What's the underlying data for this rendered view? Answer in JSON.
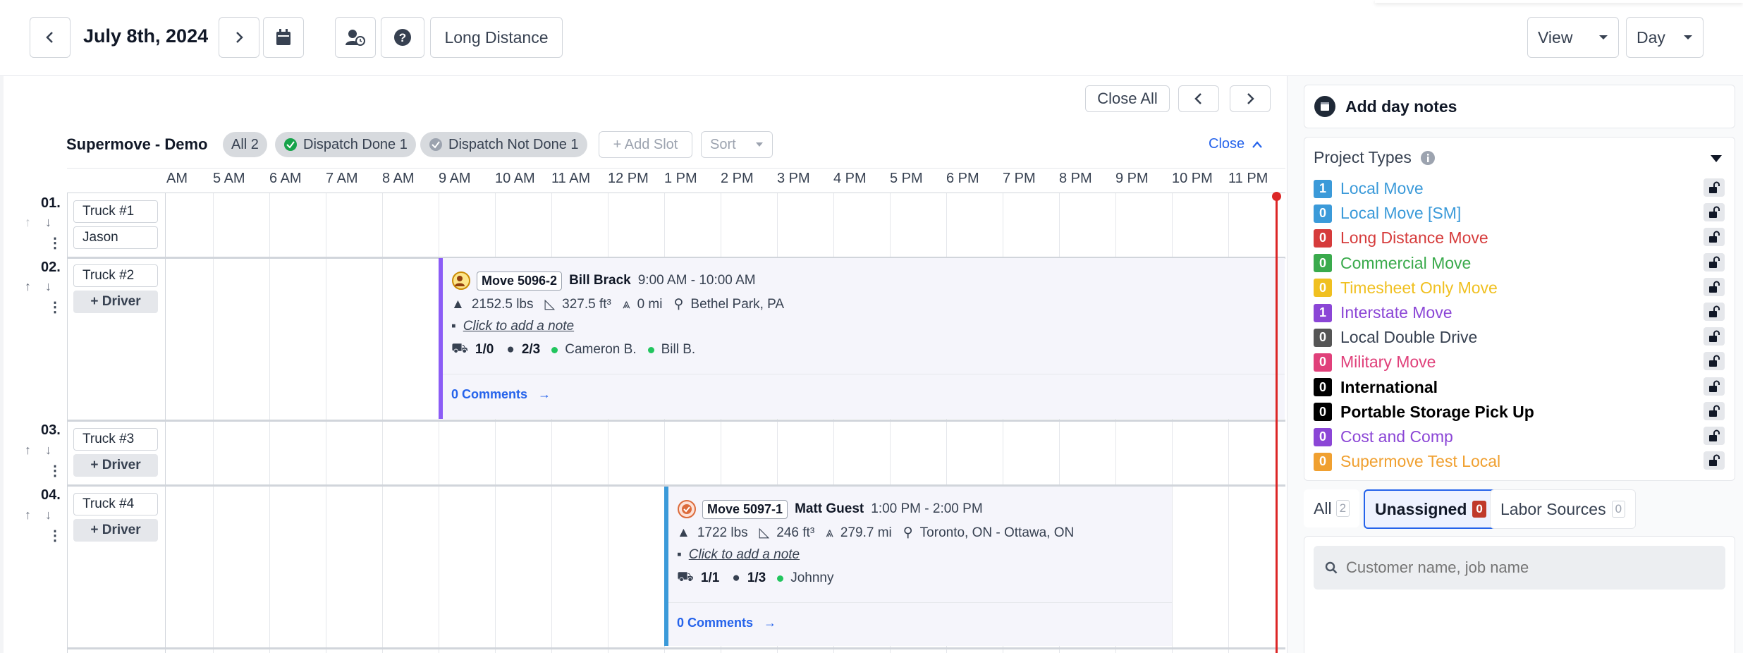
{
  "header": {
    "date": "July 8th, 2024",
    "long_distance": "Long Distance",
    "view_label": "View",
    "day_label": "Day"
  },
  "schedule": {
    "title": "Supermove - Demo",
    "filters": {
      "all": "All 2",
      "dispatch_done": "Dispatch Done 1",
      "dispatch_not_done": "Dispatch Not Done 1"
    },
    "add_slot": "+ Add Slot",
    "sort": "Sort",
    "close": "Close",
    "close_all": "Close All",
    "hours": [
      "AM",
      "5 AM",
      "6 AM",
      "7 AM",
      "8 AM",
      "9 AM",
      "10 AM",
      "11 AM",
      "12 PM",
      "1 PM",
      "2 PM",
      "3 PM",
      "4 PM",
      "5 PM",
      "6 PM",
      "7 PM",
      "8 PM",
      "9 PM",
      "10 PM",
      "11 PM"
    ],
    "rows": [
      {
        "num": "01.",
        "truck": "Truck #1",
        "driver": "Jason"
      },
      {
        "num": "02.",
        "truck": "Truck #2",
        "driver": "+ Driver"
      },
      {
        "num": "03.",
        "truck": "Truck #3",
        "driver": "+ Driver"
      },
      {
        "num": "04.",
        "truck": "Truck #4",
        "driver": "+ Driver"
      }
    ],
    "jobs": [
      {
        "move": "Move 5096-2",
        "customer": "Bill Brack",
        "time": "9:00 AM - 10:00 AM",
        "weight": "2152.5 lbs",
        "volume": "327.5 ft³",
        "distance": "0 mi",
        "location": "Bethel Park, PA",
        "note": "Click to add a note",
        "trucks": "1/0",
        "crew": "2/3",
        "crew_names": [
          "Cameron B.",
          "Bill B."
        ],
        "comments": "0 Comments"
      },
      {
        "move": "Move 5097-1",
        "customer": "Matt Guest",
        "time": "1:00 PM - 2:00 PM",
        "weight": "1722 lbs",
        "volume": "246 ft³",
        "distance": "279.7 mi",
        "location": "Toronto, ON - Ottawa, ON",
        "note": "Click to add a note",
        "trucks": "1/1",
        "crew": "1/3",
        "crew_names": [
          "Johnny"
        ],
        "comments": "0 Comments"
      }
    ]
  },
  "sidebar": {
    "add_day_notes": "Add day notes",
    "project_types_title": "Project Types",
    "project_types": [
      {
        "count": "1",
        "label": "Local Move",
        "color": "#3b9ad9"
      },
      {
        "count": "0",
        "label": "Local Move [SM]",
        "color": "#3b9ad9"
      },
      {
        "count": "0",
        "label": "Long Distance Move",
        "color": "#d63b3b"
      },
      {
        "count": "0",
        "label": "Commercial Move",
        "color": "#3aaa4c"
      },
      {
        "count": "0",
        "label": "Timesheet Only Move",
        "color": "#f0c020"
      },
      {
        "count": "1",
        "label": "Interstate Move",
        "color": "#8b46d6"
      },
      {
        "count": "0",
        "label": "Local Double Drive",
        "color": "#555555"
      },
      {
        "count": "0",
        "label": "Military Move",
        "color": "#e0407a"
      },
      {
        "count": "0",
        "label": "International",
        "color": "#000000"
      },
      {
        "count": "0",
        "label": "Portable Storage Pick Up",
        "color": "#000000"
      },
      {
        "count": "0",
        "label": "Cost and Comp",
        "color": "#8b46d6"
      },
      {
        "count": "0",
        "label": "Supermove Test Local",
        "color": "#f0a030"
      }
    ],
    "tabs": [
      {
        "label": "All",
        "count": "2"
      },
      {
        "label": "Unassigned",
        "count": "0"
      },
      {
        "label": "Labor Sources",
        "count": "0"
      }
    ],
    "search_placeholder": "Customer name, job name"
  }
}
